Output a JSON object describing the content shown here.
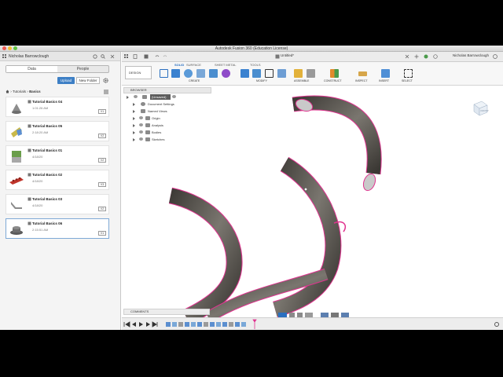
{
  "window": {
    "title": "Autodesk Fusion 360 (Education License)"
  },
  "data_panel": {
    "user": "Nicholas Barrowclough",
    "tabs": [
      {
        "label": "Data",
        "active": true
      },
      {
        "label": "People",
        "active": false
      }
    ],
    "upload_label": "Upload",
    "new_folder_label": "New Folder",
    "breadcrumb": [
      "Tutorials",
      "Basics"
    ],
    "items": [
      {
        "name": "Tutorial Basics 04",
        "date": "1:01:26 AM",
        "version": "V1",
        "color": "#8c8c8c"
      },
      {
        "name": "Tutorial Basics 05",
        "date": "2:18:20 AM",
        "version": "V2",
        "color": "#c9b94a"
      },
      {
        "name": "Tutorial Basics 01",
        "date": "4/18/20",
        "version": "V2",
        "color": "#6a9e4a"
      },
      {
        "name": "Tutorial Basics 02",
        "date": "4/18/20",
        "version": "V3",
        "color": "#c0352b"
      },
      {
        "name": "Tutorial Basics 03",
        "date": "4/18/20",
        "version": "V2",
        "color": "#8a8a8a"
      },
      {
        "name": "Tutorial Basics 06",
        "date": "2:15:51 AM",
        "version": "V1",
        "color": "#5a5a5a"
      }
    ]
  },
  "workspace": {
    "document_tab": "Untitled*",
    "user": "Nicholas Barrowclough",
    "toolbar_tabs": [
      "SOLID",
      "SURFACE",
      "SHEET METAL",
      "TOOLS"
    ],
    "design_label": "DESIGN",
    "groups": [
      "CREATE",
      "MODIFY",
      "ASSEMBLE",
      "CONSTRUCT",
      "INSPECT",
      "INSERT",
      "SELECT"
    ],
    "browser": {
      "title": "BROWSER",
      "root": "(Unsaved)",
      "items": [
        "Document Settings",
        "Named Views",
        "Origin",
        "Analysis",
        "Bodies",
        "Sketches"
      ]
    },
    "viewcube_label": "FRONT",
    "comments_label": "COMMENTS"
  },
  "colors": {
    "accent": "#3d7fc5",
    "model": "#5a5650",
    "edge": "#e0338f"
  },
  "icons": [
    "gear-icon",
    "refresh-icon",
    "search-icon",
    "home-icon",
    "eye-icon",
    "folder-icon",
    "chevron-down-icon"
  ]
}
